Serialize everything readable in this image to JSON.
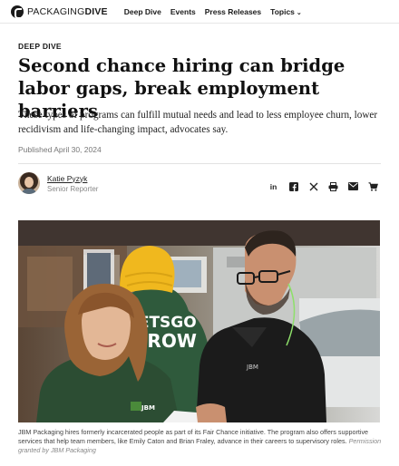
{
  "site": {
    "logo_light": "PACKAGING",
    "logo_bold": "DIVE"
  },
  "nav": {
    "items": [
      "Deep Dive",
      "Events",
      "Press Releases"
    ],
    "topics": "Topics",
    "topics_chevron": "⌄"
  },
  "article": {
    "kicker": "DEEP DIVE",
    "headline": "Second chance hiring can bridge labor gaps, break employment barriers",
    "dek": "These types of programs can fulfill mutual needs and lead to less employee churn, lower recidivism and life-changing impact, advocates say.",
    "published": "Published April 30, 2024"
  },
  "author": {
    "name": "Katie Pyzyk",
    "role": "Senior Reporter"
  },
  "share": {
    "icons": [
      "linkedin-icon",
      "facebook-icon",
      "x-icon",
      "print-icon",
      "email-icon",
      "cart-icon"
    ],
    "labels": [
      "in",
      "f",
      "𝕏",
      "⎙",
      "✉",
      "🛒"
    ]
  },
  "photo": {
    "shirt_text_1": "LETSGO",
    "shirt_text_2": "GROW",
    "shirt_logo": "JBM"
  },
  "caption": {
    "text": "JBM Packaging hires formerly incarcerated people as part of its Fair Chance initiative. The program also offers supportive services that help team members, like Emily Caton and Brian Fraley, advance in their careers to supervisory roles.",
    "credit": "Permission granted by JBM Packaging"
  },
  "colors": {
    "accent_beanie": "#f0b81e",
    "shirt_green": "#2f5a3c",
    "shirt_black": "#1b1b1b"
  }
}
